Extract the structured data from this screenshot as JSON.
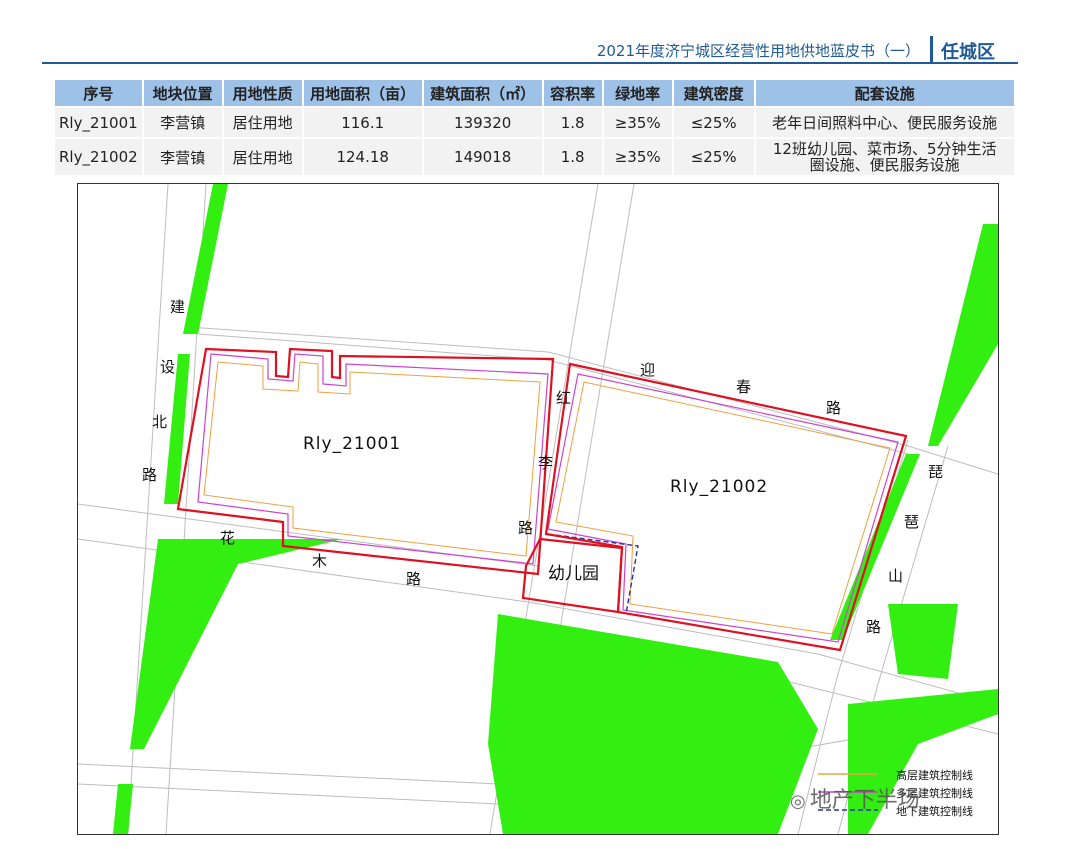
{
  "header": {
    "title": "2021年度济宁城区经营性用地供地蓝皮书（一）",
    "district": "任城区"
  },
  "table": {
    "headers": [
      "序号",
      "地块位置",
      "用地性质",
      "用地面积（亩）",
      "建筑面积（㎡）",
      "容积率",
      "绿地率",
      "建筑密度",
      "配套设施"
    ],
    "rows": [
      {
        "id": "Rly_21001",
        "location": "李营镇",
        "use": "居住用地",
        "area_mu": "116.1",
        "floor_area": "139320",
        "far": "1.8",
        "green": "≥35%",
        "density": "≤25%",
        "facilities_1": "老年日间照料中心、便民服务设施",
        "facilities_2": ""
      },
      {
        "id": "Rly_21002",
        "location": "李营镇",
        "use": "居住用地",
        "area_mu": "124.18",
        "floor_area": "149018",
        "far": "1.8",
        "green": "≥35%",
        "density": "≤25%",
        "facilities_1": "12班幼儿园、菜市场、5分钟生活",
        "facilities_2": "圈设施、便民服务设施"
      }
    ]
  },
  "map": {
    "parcels": [
      "Rly_21001",
      "Rly_21002"
    ],
    "kindergarten": "幼儿园",
    "roads": {
      "jianshe": [
        "建",
        "设",
        "北",
        "路"
      ],
      "hongli": [
        "红",
        "李",
        "路"
      ],
      "huamu": [
        "花",
        "木",
        "路"
      ],
      "yingchun": [
        "迎",
        "春",
        "路"
      ],
      "pipashan": [
        "琵",
        "琶",
        "山",
        "路"
      ]
    },
    "legend": [
      "高层建筑控制线",
      "多层建筑控制线",
      "地下建筑控制线"
    ],
    "colors": {
      "green": "#33ee11",
      "boundary": "#dd1122",
      "high": "#f0a040",
      "multi": "#cc44cc",
      "under": "#2233aa"
    }
  },
  "watermark": "地产下半场"
}
